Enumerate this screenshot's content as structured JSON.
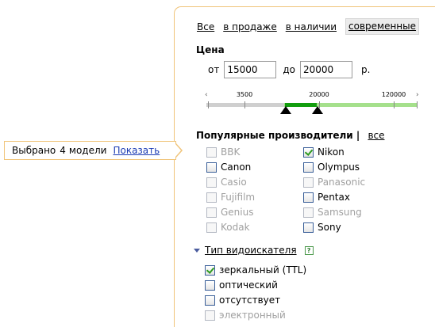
{
  "tabs": [
    {
      "label": "Все",
      "active": false
    },
    {
      "label": "в продаже",
      "active": false
    },
    {
      "label": "в наличии",
      "active": false
    },
    {
      "label": "современные",
      "active": true
    }
  ],
  "price": {
    "title": "Цена",
    "from_label": "от",
    "from_value": "15000",
    "to_label": "до",
    "to_value": "20000",
    "currency": "р."
  },
  "slider": {
    "ticks": [
      "3500",
      "20000",
      "120000"
    ],
    "left_arrow": "‹",
    "right_arrow": "›",
    "range_from": 15000,
    "range_to": 20000,
    "colors": {
      "range": "#129d0e",
      "track": "#a5e08c",
      "inactive": "#cfcfcf"
    }
  },
  "manufacturers": {
    "title": "Популярные производители |",
    "all_link": "все",
    "items": [
      {
        "label": "BBK",
        "checked": false,
        "disabled": true
      },
      {
        "label": "Nikon",
        "checked": true,
        "disabled": false
      },
      {
        "label": "Canon",
        "checked": false,
        "disabled": false
      },
      {
        "label": "Olympus",
        "checked": false,
        "disabled": false
      },
      {
        "label": "Casio",
        "checked": false,
        "disabled": true
      },
      {
        "label": "Panasonic",
        "checked": false,
        "disabled": true
      },
      {
        "label": "Fujifilm",
        "checked": false,
        "disabled": true
      },
      {
        "label": "Pentax",
        "checked": false,
        "disabled": false
      },
      {
        "label": "Genius",
        "checked": false,
        "disabled": true
      },
      {
        "label": "Samsung",
        "checked": false,
        "disabled": true
      },
      {
        "label": "Kodak",
        "checked": false,
        "disabled": true
      },
      {
        "label": "Sony",
        "checked": false,
        "disabled": false
      }
    ]
  },
  "viewfinder": {
    "title": "Тип видоискателя",
    "help": "?",
    "items": [
      {
        "label": "зеркальный (TTL)",
        "checked": true,
        "disabled": false
      },
      {
        "label": "оптический",
        "checked": false,
        "disabled": false
      },
      {
        "label": "отсутствует",
        "checked": false,
        "disabled": false
      },
      {
        "label": "электронный",
        "checked": false,
        "disabled": true
      }
    ]
  },
  "selection": {
    "prefix": "Выбрано",
    "count": "4",
    "unit": "модели",
    "show_link": "Показать"
  },
  "colors": {
    "panel_border": "#f0c479",
    "link": "#1a3ab3",
    "check": "#2c9a1e"
  }
}
